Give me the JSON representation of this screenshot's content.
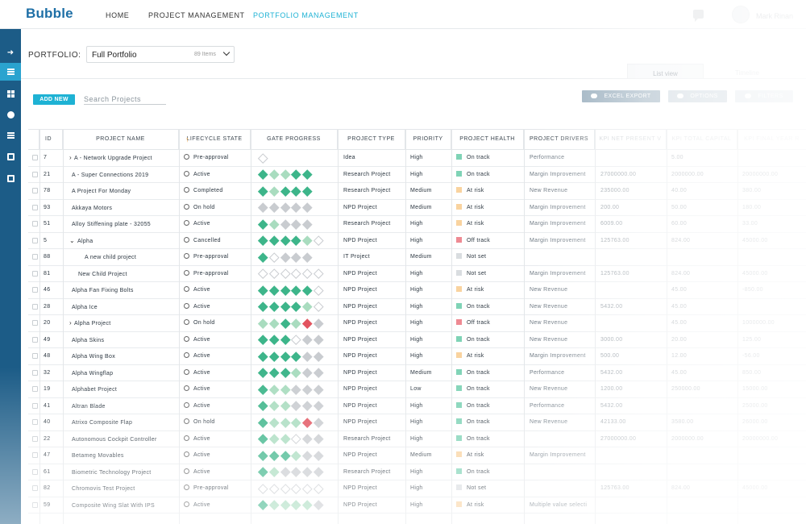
{
  "app": {
    "logo": "Bubble",
    "user_name": "Mark Rinan"
  },
  "nav": {
    "home": "HOME",
    "project_management": "PROJECT MANAGEMENT",
    "portfolio_management": "PORTFOLIO MANAGEMENT"
  },
  "portfolio": {
    "label": "PORTFOLIO:",
    "value": "Full Portfolio",
    "count": "89 Items"
  },
  "tabs": {
    "list_view": "List view",
    "timeline": "Timeline"
  },
  "toolbar": {
    "add_new": "ADD NEW",
    "search_placeholder": "Search Projects",
    "excel_export": "EXCEL EXPORT",
    "options": "OPTIONS",
    "filters": "FILTERS"
  },
  "colors": {
    "accent": "#1eb2d4",
    "sidebar": "#1c5c87",
    "on_track": "#7fd3b6",
    "at_risk": "#f9d39f",
    "off_track": "#ee8a93",
    "not_set": "#d9dde0",
    "gate_done": "#3db58a",
    "gate_partial": "#a9dcbf",
    "gate_pending": "#c9ccd0",
    "gate_red": "#e2545f"
  },
  "columns": {
    "id": "ID",
    "name": "PROJECT NAME",
    "lifecycle": "LIFECYCLE STATE",
    "gates": "GATE PROGRESS",
    "type": "PROJECT TYPE",
    "priority": "PRIORITY",
    "health": "PROJECT HEALTH",
    "drivers": "PROJECT DRIVERS",
    "kpi_npv": "KPI NET PRESENT V",
    "kpi_capital": "KPI TOTAL CAPITAL",
    "kpi_final": "KPI FINAL YEAR R"
  },
  "rows": [
    {
      "id": "7",
      "name": "A - Network Upgrade Project",
      "expander": "›",
      "indent": 0,
      "lifecycle": "Pre-approval",
      "lc_icon": "lightbulb-icon",
      "gates": "o",
      "type": "Idea",
      "priority": "High",
      "health": "On track",
      "driver": "Performance",
      "npv": "",
      "capital": "5.00",
      "final": ""
    },
    {
      "id": "21",
      "name": "A - Super Connections 2019",
      "expander": "",
      "indent": 0,
      "lifecycle": "Active",
      "lc_icon": "play-icon",
      "gates": "gppgg",
      "type": "Research Project",
      "priority": "High",
      "health": "On track",
      "driver": "Margin Improvement",
      "npv": "27000000.00",
      "capital": "2000000.00",
      "final": "20000000.00"
    },
    {
      "id": "78",
      "name": "A Project For Monday",
      "expander": "",
      "indent": 0,
      "lifecycle": "Completed",
      "lc_icon": "check-icon",
      "gates": "gpggg",
      "type": "Research Project",
      "priority": "Medium",
      "health": "At risk",
      "driver": "New Revenue",
      "npv": "235000.00",
      "capital": "40.00",
      "final": "380.00"
    },
    {
      "id": "93",
      "name": "Akkaya Motors",
      "expander": "",
      "indent": 0,
      "lifecycle": "On hold",
      "lc_icon": "pause-icon",
      "gates": "xxxxx",
      "type": "NPD Project",
      "priority": "Medium",
      "health": "At risk",
      "driver": "Margin Improvement",
      "npv": "200.00",
      "capital": "50.00",
      "final": "180.00"
    },
    {
      "id": "51",
      "name": "Alloy Stiffening plate - 32055",
      "expander": "",
      "indent": 0,
      "lifecycle": "Active",
      "lc_icon": "play-icon",
      "gates": "gpxxx",
      "type": "Research Project",
      "priority": "High",
      "health": "At risk",
      "driver": "Margin Improvement",
      "npv": "6009.00",
      "capital": "60.00",
      "final": "33.00"
    },
    {
      "id": "5",
      "name": "Alpha",
      "expander": "⌄",
      "indent": 0,
      "lifecycle": "Cancelled",
      "lc_icon": "cancel-icon",
      "gates": "ggggpo",
      "type": "NPD Project",
      "priority": "High",
      "health": "Off track",
      "driver": "Margin Improvement",
      "npv": "125763.00",
      "capital": "824.00",
      "final": "45000.00"
    },
    {
      "id": "88",
      "name": "A new child project",
      "expander": "",
      "indent": 2,
      "lifecycle": "Pre-approval",
      "lc_icon": "lightbulb-icon",
      "gates": "goxxx",
      "type": "IT Project",
      "priority": "Medium",
      "health": "Not set",
      "driver": "",
      "npv": "",
      "capital": "",
      "final": ""
    },
    {
      "id": "81",
      "name": "New Child Project",
      "expander": "",
      "indent": 1,
      "lifecycle": "Pre-approval",
      "lc_icon": "lightbulb-icon",
      "gates": "oooooo",
      "type": "NPD Project",
      "priority": "High",
      "health": "Not set",
      "driver": "Margin Improvement",
      "npv": "125763.00",
      "capital": "824.00",
      "final": "45000.00"
    },
    {
      "id": "46",
      "name": "Alpha Fan Fixing Bolts",
      "expander": "",
      "indent": 0,
      "lifecycle": "Active",
      "lc_icon": "play-icon",
      "gates": "gggggo",
      "type": "NPD Project",
      "priority": "High",
      "health": "At risk",
      "driver": "New Revenue",
      "npv": "",
      "capital": "45.00",
      "final": "-850.00"
    },
    {
      "id": "28",
      "name": "Alpha Ice",
      "expander": "",
      "indent": 0,
      "lifecycle": "Active",
      "lc_icon": "play-icon",
      "gates": "ggggpo",
      "type": "NPD Project",
      "priority": "High",
      "health": "On track",
      "driver": "New Revenue",
      "npv": "5432.00",
      "capital": "45.00",
      "final": ""
    },
    {
      "id": "20",
      "name": "Alpha Project",
      "expander": "›",
      "indent": 0,
      "lifecycle": "On hold",
      "lc_icon": "pause-icon",
      "gates": "ppgprx",
      "type": "NPD Project",
      "priority": "High",
      "health": "Off track",
      "driver": "New Revenue",
      "npv": "",
      "capital": "45.00",
      "final": "1000000.00"
    },
    {
      "id": "49",
      "name": "Alpha Skins",
      "expander": "",
      "indent": 0,
      "lifecycle": "Active",
      "lc_icon": "play-icon",
      "gates": "gggoxx",
      "type": "NPD Project",
      "priority": "High",
      "health": "On track",
      "driver": "New Revenue",
      "npv": "3000.00",
      "capital": "20.00",
      "final": "125.00"
    },
    {
      "id": "48",
      "name": "Alpha Wing Box",
      "expander": "",
      "indent": 0,
      "lifecycle": "Active",
      "lc_icon": "play-icon",
      "gates": "ggggxx",
      "type": "NPD Project",
      "priority": "High",
      "health": "At risk",
      "driver": "Margin Improvement",
      "npv": "500.00",
      "capital": "12.00",
      "final": "-56.00"
    },
    {
      "id": "32",
      "name": "Alpha Wingflap",
      "expander": "",
      "indent": 0,
      "lifecycle": "Active",
      "lc_icon": "play-icon",
      "gates": "gggpxx",
      "type": "NPD Project",
      "priority": "Medium",
      "health": "On track",
      "driver": "Performance",
      "npv": "5432.00",
      "capital": "45.00",
      "final": "850.00"
    },
    {
      "id": "19",
      "name": "Alphabet Project",
      "expander": "",
      "indent": 0,
      "lifecycle": "Active",
      "lc_icon": "play-icon",
      "gates": "gppxxx",
      "type": "NPD Project",
      "priority": "Low",
      "health": "On track",
      "driver": "New Revenue",
      "npv": "1200.00",
      "capital": "250000.00",
      "final": "15000.00"
    },
    {
      "id": "41",
      "name": "Altran Blade",
      "expander": "",
      "indent": 0,
      "lifecycle": "Active",
      "lc_icon": "play-icon",
      "gates": "gppxxx",
      "type": "NPD Project",
      "priority": "High",
      "health": "On track",
      "driver": "Performance",
      "npv": "5432.00",
      "capital": "",
      "final": "25000.00"
    },
    {
      "id": "40",
      "name": "Atrixo Composite Flap",
      "expander": "",
      "indent": 0,
      "lifecycle": "On hold",
      "lc_icon": "pause-icon",
      "gates": "gppprx",
      "type": "NPD Project",
      "priority": "High",
      "health": "On track",
      "driver": "New Revenue",
      "npv": "42133.00",
      "capital": "3580.00",
      "final": "26000.00"
    },
    {
      "id": "22",
      "name": "Autonomous Cockpit Controller",
      "expander": "",
      "indent": 0,
      "lifecycle": "Active",
      "lc_icon": "play-icon",
      "gates": "gppoxx",
      "type": "Research Project",
      "priority": "High",
      "health": "On track",
      "driver": "",
      "npv": "27000000.00",
      "capital": "2000000.00",
      "final": "20000000.00"
    },
    {
      "id": "47",
      "name": "Betameg Movables",
      "expander": "",
      "indent": 0,
      "lifecycle": "Active",
      "lc_icon": "play-icon",
      "gates": "gggpxx",
      "type": "NPD Project",
      "priority": "Medium",
      "health": "At risk",
      "driver": "Margin Improvement",
      "npv": "",
      "capital": "",
      "final": ""
    },
    {
      "id": "61",
      "name": "Biometric Technology Project",
      "expander": "",
      "indent": 0,
      "lifecycle": "Active",
      "lc_icon": "play-icon",
      "gates": "gpxxxx",
      "type": "Research Project",
      "priority": "High",
      "health": "On track",
      "driver": "",
      "npv": "",
      "capital": "",
      "final": ""
    },
    {
      "id": "82",
      "name": "Chromovis Test Project",
      "expander": "",
      "indent": 0,
      "lifecycle": "Pre-approval",
      "lc_icon": "lightbulb-icon",
      "gates": "oooooo",
      "type": "NPD Project",
      "priority": "High",
      "health": "Not set",
      "driver": "",
      "npv": "125763.00",
      "capital": "824.00",
      "final": "45000.00"
    },
    {
      "id": "59",
      "name": "Composite Wing Slat With IPS",
      "expander": "",
      "indent": 0,
      "lifecycle": "Active",
      "lc_icon": "play-icon",
      "gates": "gppppx",
      "type": "NPD Project",
      "priority": "High",
      "health": "At risk",
      "driver": "Multiple value selecti",
      "npv": "",
      "capital": "",
      "final": ""
    }
  ]
}
